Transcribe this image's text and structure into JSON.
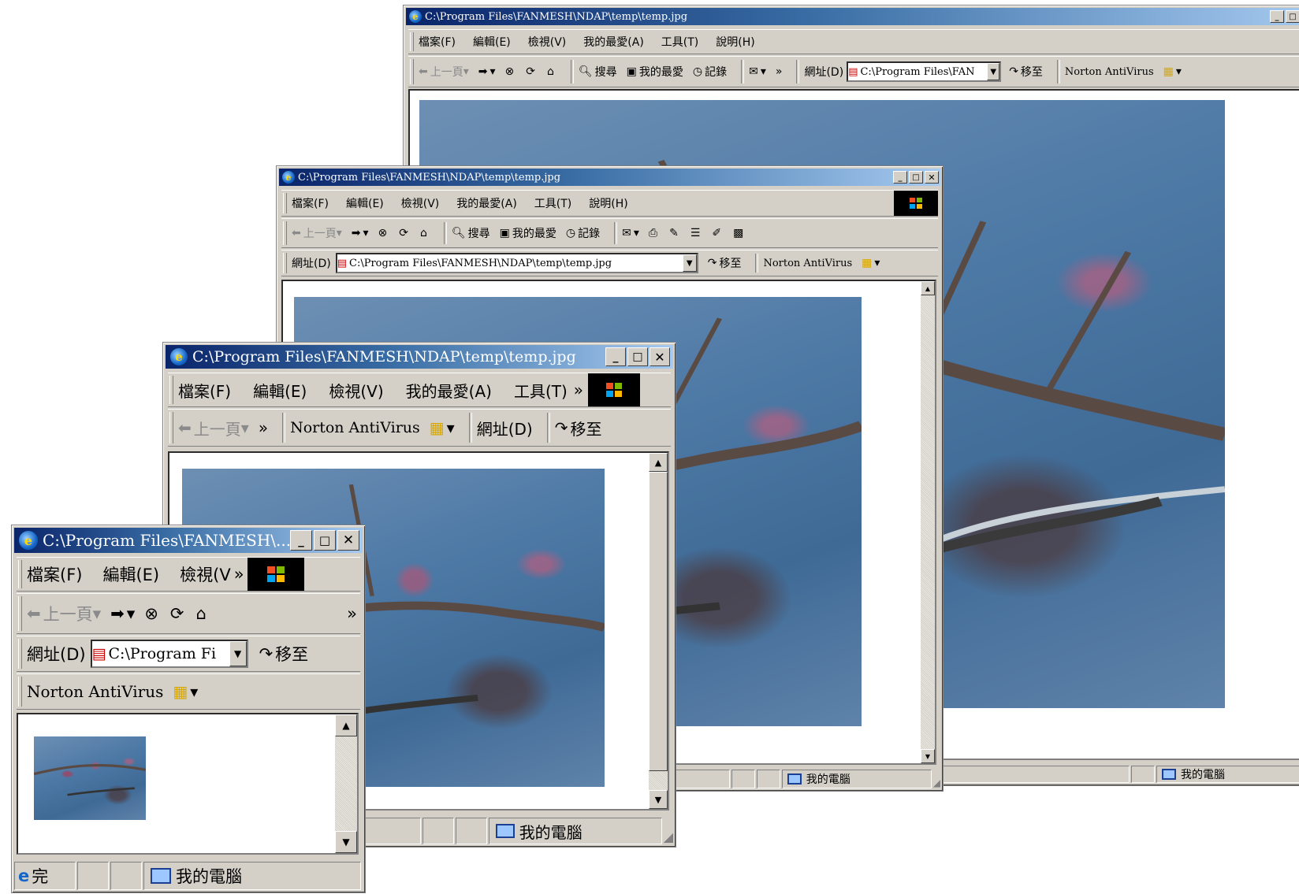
{
  "windows": {
    "w1": {
      "title": "C:\\Program Files\\FANMESH\\NDAP\\temp\\temp.jpg",
      "menu": [
        "檔案(F)",
        "編輯(E)",
        "檢視(V)",
        "我的最愛(A)",
        "工具(T)",
        "說明(H)"
      ],
      "toolbar": {
        "back": "上一頁",
        "search": "搜尋",
        "favorites": "我的最愛",
        "history": "記錄",
        "more": "»"
      },
      "address_label": "網址(D)",
      "address_value": "C:\\Program Files\\FAN",
      "go": "移至",
      "norton": "Norton AntiVirus",
      "status_zone": "我的電腦"
    },
    "w2": {
      "title": "C:\\Program Files\\FANMESH\\NDAP\\temp\\temp.jpg",
      "menu": [
        "檔案(F)",
        "編輯(E)",
        "檢視(V)",
        "我的最愛(A)",
        "工具(T)",
        "說明(H)"
      ],
      "toolbar": {
        "back": "上一頁",
        "search": "搜尋",
        "favorites": "我的最愛",
        "history": "記錄"
      },
      "address_label": "網址(D)",
      "address_value": "C:\\Program Files\\FANMESH\\NDAP\\temp\\temp.jpg",
      "go": "移至",
      "norton": "Norton AntiVirus",
      "status_zone": "我的電腦"
    },
    "w3": {
      "title": "C:\\Program Files\\FANMESH\\NDAP\\temp\\temp.jpg",
      "menu": [
        "檔案(F)",
        "編輯(E)",
        "檢視(V)",
        "我的最愛(A)",
        "工具(T)"
      ],
      "more": "»",
      "toolbar": {
        "back": "上一頁",
        "more": "»"
      },
      "norton": "Norton AntiVirus",
      "address_label": "網址(D)",
      "go": "移至",
      "status_zone": "我的電腦"
    },
    "w4": {
      "title": "C:\\Program Files\\FANMESH\\...",
      "menu": [
        "檔案(F)",
        "編輯(E)",
        "檢視(V"
      ],
      "more": "»",
      "toolbar": {
        "back": "上一頁",
        "more": "»"
      },
      "address_label": "網址(D)",
      "address_value": "C:\\Program Fi",
      "go": "移至",
      "norton": "Norton AntiVirus",
      "status_done": "完",
      "status_zone": "我的電腦"
    }
  },
  "colors": {
    "title_active": "#0a246a",
    "title_gradient_end": "#a6caf0",
    "chrome": "#d4d0c8",
    "sky": "#4d79a6"
  },
  "icons": [
    "ie-logo-icon",
    "minimize-icon",
    "maximize-icon",
    "close-icon",
    "back-arrow-icon",
    "forward-arrow-icon",
    "stop-icon",
    "refresh-icon",
    "home-icon",
    "search-icon",
    "favorites-icon",
    "history-icon",
    "mail-icon",
    "print-icon",
    "edit-icon",
    "discuss-icon",
    "messenger-icon",
    "page-icon",
    "go-arrow-icon",
    "norton-icon",
    "dropdown-arrow-icon",
    "computer-icon",
    "windows-flag-icon"
  ]
}
